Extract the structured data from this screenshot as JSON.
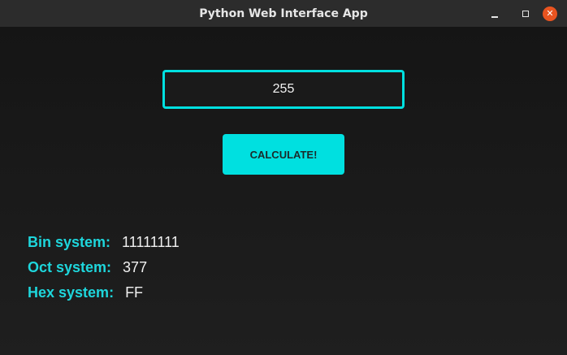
{
  "window": {
    "title": "Python Web Interface App",
    "controls": {
      "minimize_icon": "minimize-icon",
      "maximize_icon": "maximize-icon",
      "close_icon": "close-icon",
      "close_glyph": "✕"
    }
  },
  "form": {
    "input_value": "255",
    "calculate_label": "CALCULATE!"
  },
  "results": [
    {
      "label": "Bin system:",
      "value": "11111111"
    },
    {
      "label": "Oct system:",
      "value": "377"
    },
    {
      "label": "Hex system:",
      "value": "FF"
    }
  ],
  "colors": {
    "accent": "#00e0e0",
    "label": "#1ed6dc",
    "close_button": "#e95420",
    "background": "#1b1b1b"
  }
}
